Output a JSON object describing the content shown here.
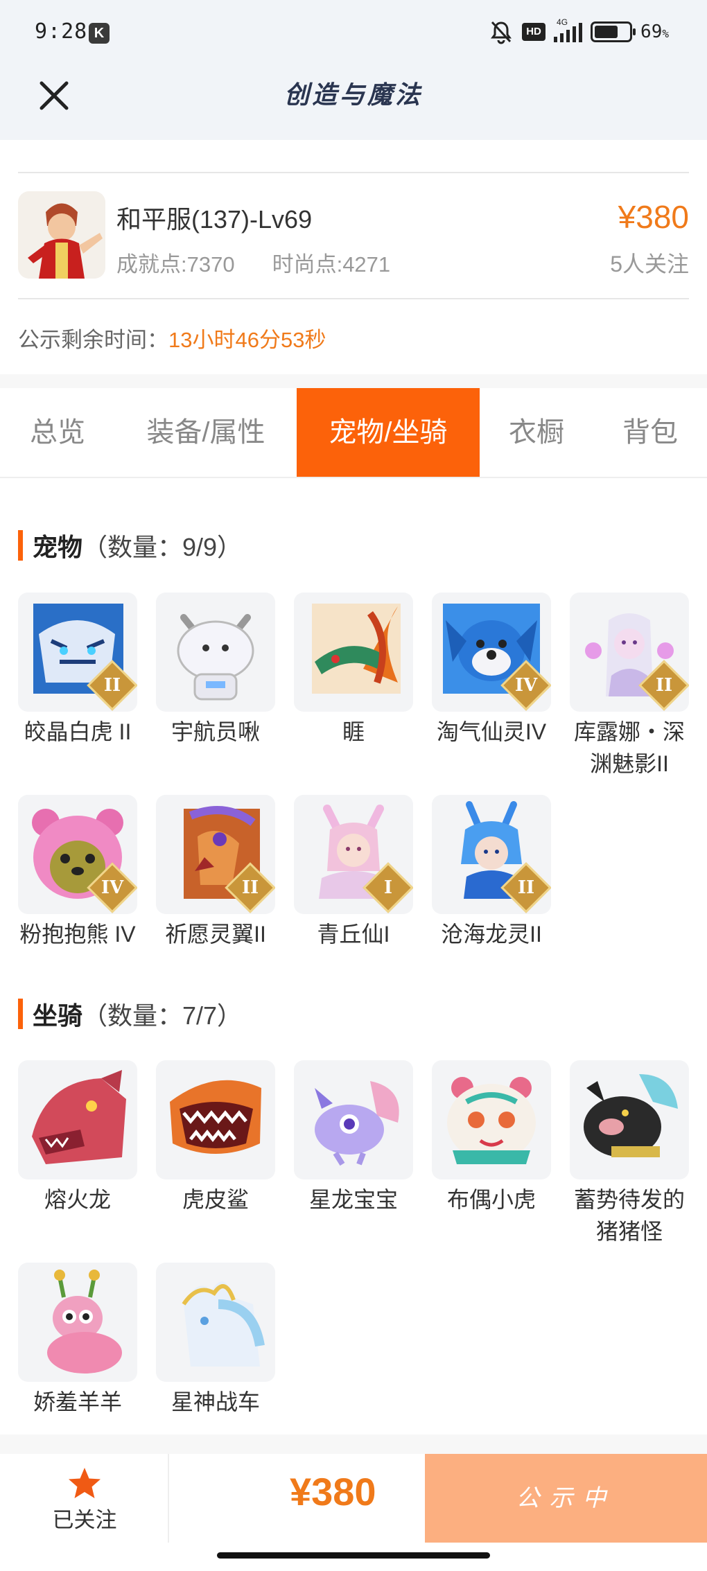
{
  "status_bar": {
    "time": "9:28",
    "app_badge": "K",
    "hd": "HD",
    "network": "4G",
    "battery": "69",
    "battery_level": 0.69
  },
  "header": {
    "title": "创造与魔法"
  },
  "character": {
    "name": "和平服(137)-Lv69",
    "achievement": "成就点:7370",
    "fashion": "时尚点:4271",
    "price": "¥380",
    "followers": "5人关注"
  },
  "timer": {
    "label": "公示剩余时间：",
    "value": "13小时46分53秒"
  },
  "tabs": [
    {
      "label": "总览",
      "active": false
    },
    {
      "label": "装备/属性",
      "active": false
    },
    {
      "label": "宠物/坐骑",
      "active": true
    },
    {
      "label": "衣橱",
      "active": false
    },
    {
      "label": "背包",
      "active": false
    }
  ],
  "pets": {
    "title": "宠物",
    "count": "（数量：9/9）",
    "items": [
      {
        "label": "皎晶白虎 II",
        "rank": "II"
      },
      {
        "label": "宇航员啾",
        "rank": ""
      },
      {
        "label": "睚",
        "rank": ""
      },
      {
        "label": "淘气仙灵IV",
        "rank": "IV"
      },
      {
        "label": "库露娜・深渊魅影II",
        "rank": "II"
      },
      {
        "label": "粉抱抱熊 IV",
        "rank": "IV"
      },
      {
        "label": "祈愿灵翼II",
        "rank": "II"
      },
      {
        "label": "青丘仙I",
        "rank": "I"
      },
      {
        "label": "沧海龙灵II",
        "rank": "II"
      }
    ]
  },
  "mounts": {
    "title": "坐骑",
    "count": "（数量：7/7）",
    "items": [
      {
        "label": "熔火龙"
      },
      {
        "label": "虎皮鲨"
      },
      {
        "label": "星龙宝宝"
      },
      {
        "label": "布偶小虎"
      },
      {
        "label": "蓄势待发的猪猪怪"
      },
      {
        "label": "娇羞羊羊"
      },
      {
        "label": "星神战车"
      }
    ]
  },
  "bottom_bar": {
    "follow_label": "已关注",
    "price": "¥380",
    "status_label": "公示中"
  },
  "colors": {
    "accent": "#fc620a",
    "price": "#f07a1a",
    "button_disabled": "#fcaf80"
  }
}
